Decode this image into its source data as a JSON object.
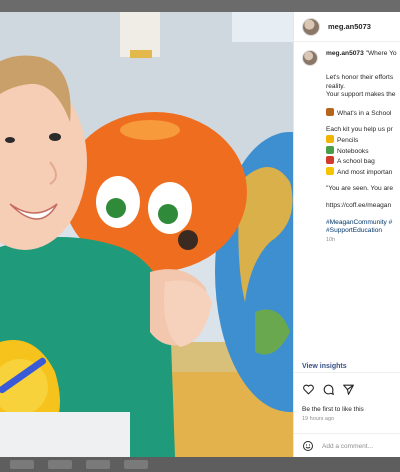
{
  "post": {
    "username": "meg.an5073",
    "caption_lead": "\"Where Yo",
    "caption_lines": [
      "Let's honor their efforts",
      "reality.",
      "Your support makes the"
    ],
    "school_line": "What's in a School",
    "kit_intro": "Each kit you help us pr",
    "kit_items": [
      {
        "icon": "pencil-emoji",
        "color": "#f2b400",
        "label": "Pencils"
      },
      {
        "icon": "notebook-emoji",
        "color": "#4a9e4a",
        "label": "Notebooks"
      },
      {
        "icon": "backpack-emoji",
        "color": "#d23a2a",
        "label": "A school bag"
      },
      {
        "icon": "heart-emoji",
        "color": "#f4c400",
        "label": "And most importan"
      }
    ],
    "quote": "\"You are seen. You are",
    "link": "https://coff.ee/meagan",
    "hashtags_line1": "#MeaganCommunity #",
    "hashtags_line2": "#SupportEducation",
    "caption_age": "10h"
  },
  "insights_label": "View insights",
  "likes_text": "Be the first to like this",
  "timestamp": "19 hours ago",
  "comment_placeholder": "Add a comment..."
}
